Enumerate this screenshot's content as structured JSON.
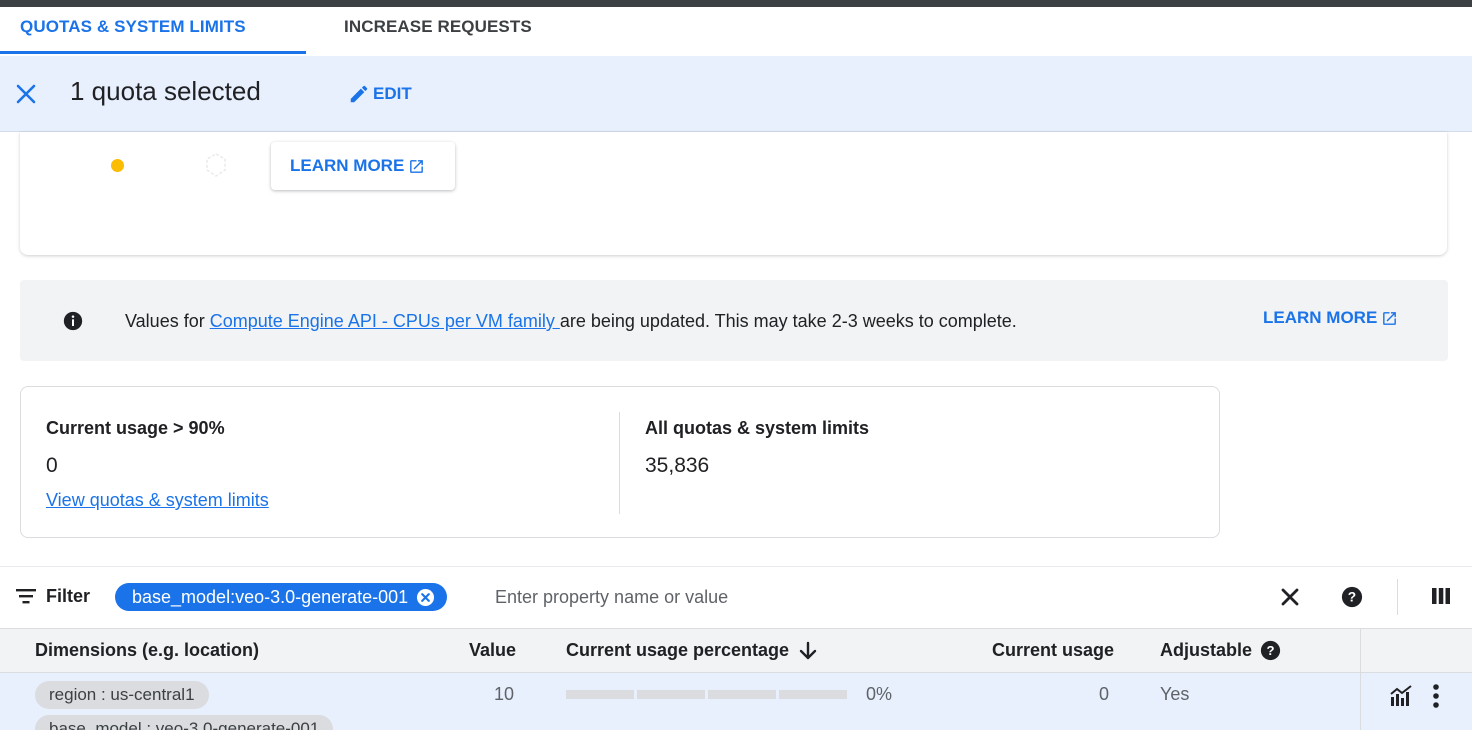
{
  "tabs": [
    {
      "label": "QUOTAS & SYSTEM LIMITS",
      "active": true
    },
    {
      "label": "INCREASE REQUESTS",
      "active": false
    }
  ],
  "selection": {
    "title": "1 quota selected",
    "edit_label": "EDIT"
  },
  "card": {
    "learn_more": "LEARN MORE"
  },
  "banner": {
    "prefix": "Values for ",
    "link": "Compute Engine API - CPUs per VM family ",
    "suffix": "are being updated. This may take 2-3 weeks to complete.",
    "learn_more": "LEARN MORE"
  },
  "summary": {
    "high_usage_label": "Current usage > 90%",
    "high_usage_value": "0",
    "view_link": "View quotas & system limits",
    "all_label": "All quotas & system limits",
    "all_value": "35,836"
  },
  "filter": {
    "label": "Filter",
    "chip": "base_model:veo-3.0-generate-001",
    "placeholder": "Enter property name or value"
  },
  "table": {
    "columns": {
      "dimensions": "Dimensions (e.g. location)",
      "value": "Value",
      "usage_pct": "Current usage percentage",
      "usage": "Current usage",
      "adjustable": "Adjustable"
    },
    "rows": [
      {
        "dim1": "region : us-central1",
        "dim2": "base_model : veo-3.0-generate-001",
        "value": "10",
        "usage_pct": "0%",
        "usage_fraction": 0,
        "usage": "0",
        "adjustable": "Yes"
      }
    ]
  },
  "colors": {
    "accent": "#1a73e8",
    "selection_bg": "#e8f0fe",
    "warning_dot": "#fbbc04"
  }
}
